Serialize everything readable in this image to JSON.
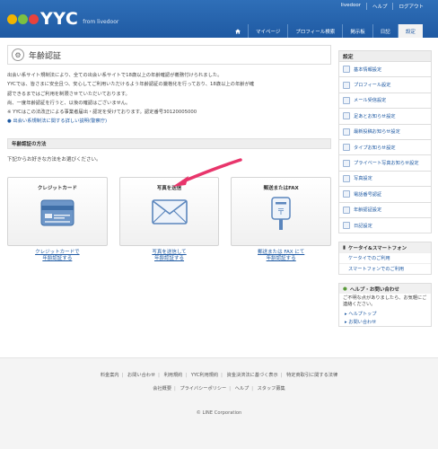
{
  "header": {
    "topbar": [
      "livedoor",
      "ヘルプ",
      "ログアウト"
    ],
    "logo_text": "YYC",
    "logo_from": "from livedoor",
    "logo_colors": [
      "#f0b400",
      "#7cc142",
      "#e8423c"
    ],
    "nav_tabs": [
      {
        "label": "",
        "icon": "home-icon"
      },
      {
        "label": "マイページ"
      },
      {
        "label": "プロフィール検索"
      },
      {
        "label": "掲示板"
      },
      {
        "label": "日記"
      },
      {
        "label": "設定",
        "active": true
      }
    ]
  },
  "main": {
    "title": "年齢認証",
    "intro_lines": [
      "出会い系サイト規制法により、全ての出会い系サイトで18歳以上の年齢確認が義務付けられました。",
      "YYCでは、皆さまに安全且つ、安心してご利用いただけるよう年齢認証の厳格化を行っており、18歳以上の年齢が確",
      "認できるまではご利用を制限させていただいております。",
      "尚、一度年齢認証を行うと、以後の確認はございません。",
      "※ YYCはこの法改正による事業者届出・認定を受けております。認定番号30120005000"
    ],
    "intro_link": "出会い系規制法に関する詳しい説明(警察庁)",
    "method_heading": "年齢認証の方法",
    "method_note": "下記からお好きな方法をお選びください。",
    "cards": [
      {
        "title": "クレジットカード",
        "link_lines": [
          "クレジットカードで",
          "年齢認証する"
        ],
        "icon": "credit-card-icon"
      },
      {
        "title": "写真を送信",
        "link_lines": [
          "写真を送信して",
          "年齢認証する"
        ],
        "icon": "envelope-icon"
      },
      {
        "title": "郵送またはFAX",
        "link_lines": [
          "郵送または FAX にて",
          "年齢認証する"
        ],
        "icon": "postbox-icon"
      }
    ],
    "arrow_color": "#e8356b"
  },
  "sidebar": {
    "heading": "設定",
    "items": [
      "基本情報設定",
      "プロフィール設定",
      "メール受信設定",
      "足あとお知らせ設定",
      "最新投稿お知らせ設定",
      "タイプお知らせ設定",
      "プライベート写真お知らせ設定",
      "写真設定",
      "電話番号認証",
      "年齢認証設定",
      "日記設定"
    ],
    "mobile_heading": "ケータイ&スマートフォン",
    "mobile_links": [
      "ケータイでのご利用",
      "スマートフォンでのご利用"
    ],
    "help_heading": "ヘルプ・お問い合わせ",
    "help_text": "ご不明な点がありましたら、お気軽にご連絡ください。",
    "help_links": [
      "ヘルプトップ",
      "お問い合わせ"
    ]
  },
  "footer": {
    "links_row1": [
      "料金案内",
      "お問い合わせ",
      "利用規約",
      "YYC利用規約",
      "資金決済法に基づく表示",
      "特定商取引に関する法律"
    ],
    "links_row2": [
      "会社概要",
      "プライバシーポリシー",
      "ヘルプ",
      "スタッフ募集"
    ],
    "copyright": "© LINE Corporation"
  }
}
